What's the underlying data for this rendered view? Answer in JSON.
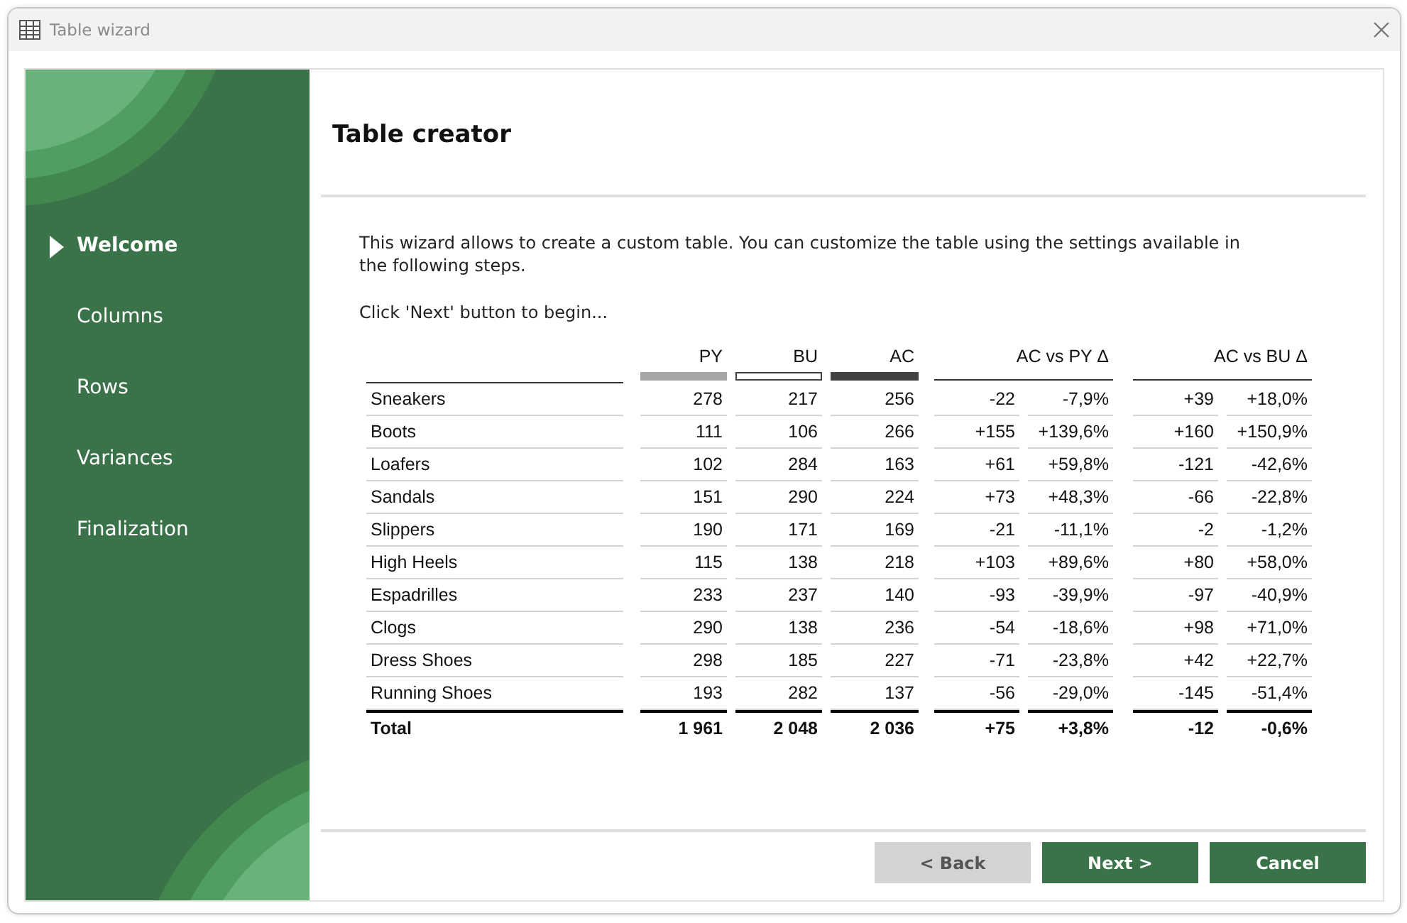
{
  "window": {
    "title": "Table wizard"
  },
  "sidebar": {
    "items": [
      {
        "label": "Welcome",
        "selected": true
      },
      {
        "label": "Columns",
        "selected": false
      },
      {
        "label": "Rows",
        "selected": false
      },
      {
        "label": "Variances",
        "selected": false
      },
      {
        "label": "Finalization",
        "selected": false
      }
    ]
  },
  "page": {
    "title": "Table creator",
    "intro": "This wizard allows to create a custom table. You can customize the table using the settings available in the following steps.",
    "hint": "Click 'Next' button to begin..."
  },
  "table": {
    "columns": [
      {
        "label": "PY",
        "kind": "gray"
      },
      {
        "label": "BU",
        "kind": "outline"
      },
      {
        "label": "AC",
        "kind": "dark"
      }
    ],
    "variance_groups": [
      "AC vs PY Δ",
      "AC vs BU Δ"
    ],
    "rows": [
      {
        "name": "Sneakers",
        "kind": "item",
        "values": [
          "278",
          "217",
          "256",
          "-22",
          "-7,9%",
          "+39",
          "+18,0%"
        ]
      },
      {
        "name": "Boots",
        "kind": "item",
        "values": [
          "111",
          "106",
          "266",
          "+155",
          "+139,6%",
          "+160",
          "+150,9%"
        ]
      },
      {
        "name": "Loafers",
        "kind": "item",
        "values": [
          "102",
          "284",
          "163",
          "+61",
          "+59,8%",
          "-121",
          "-42,6%"
        ]
      },
      {
        "name": "Sandals",
        "kind": "item",
        "values": [
          "151",
          "290",
          "224",
          "+73",
          "+48,3%",
          "-66",
          "-22,8%"
        ]
      },
      {
        "name": "Slippers",
        "kind": "item",
        "values": [
          "190",
          "171",
          "169",
          "-21",
          "-11,1%",
          "-2",
          "-1,2%"
        ]
      },
      {
        "name": "High Heels",
        "kind": "item",
        "values": [
          "115",
          "138",
          "218",
          "+103",
          "+89,6%",
          "+80",
          "+58,0%"
        ]
      },
      {
        "name": "Espadrilles",
        "kind": "item",
        "values": [
          "233",
          "237",
          "140",
          "-93",
          "-39,9%",
          "-97",
          "-40,9%"
        ]
      },
      {
        "name": "Clogs",
        "kind": "item",
        "values": [
          "290",
          "138",
          "236",
          "-54",
          "-18,6%",
          "+98",
          "+71,0%"
        ]
      },
      {
        "name": "Dress Shoes",
        "kind": "item",
        "values": [
          "298",
          "185",
          "227",
          "-71",
          "-23,8%",
          "+42",
          "+22,7%"
        ]
      },
      {
        "name": "Running Shoes",
        "kind": "item",
        "values": [
          "193",
          "282",
          "137",
          "-56",
          "-29,0%",
          "-145",
          "-51,4%"
        ]
      },
      {
        "name": "Total",
        "kind": "total",
        "values": [
          "1 961",
          "2 048",
          "2 036",
          "+75",
          "+3,8%",
          "-12",
          "-0,6%"
        ]
      }
    ]
  },
  "buttons": [
    {
      "label": "< Back",
      "disabled": true
    },
    {
      "label": "Next >",
      "disabled": false
    },
    {
      "label": "Cancel",
      "disabled": false
    }
  ]
}
